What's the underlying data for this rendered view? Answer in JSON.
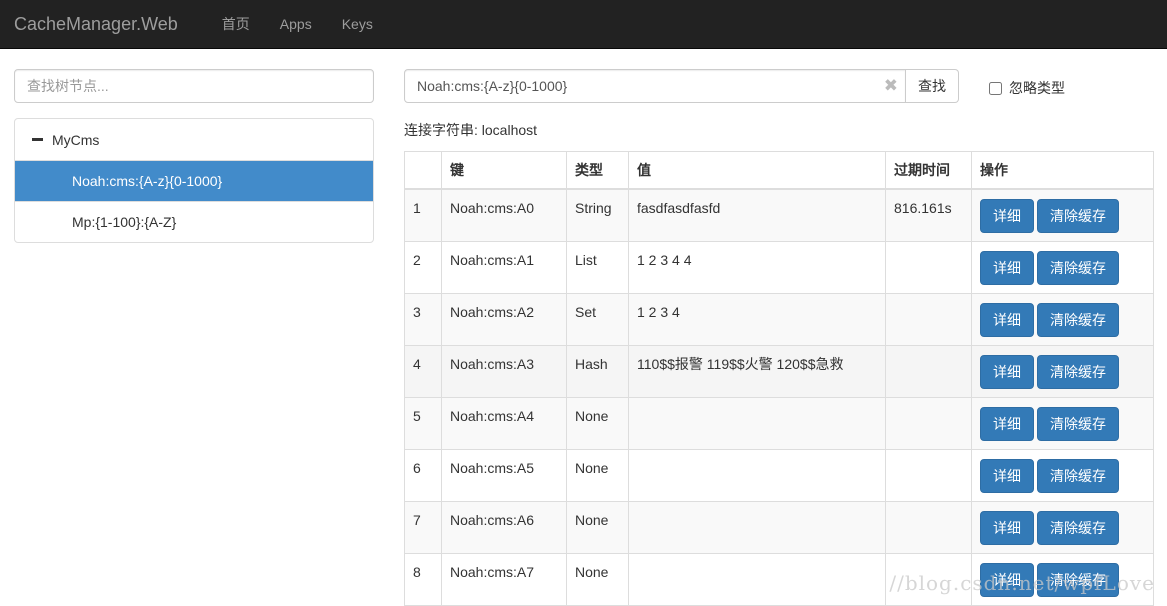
{
  "navbar": {
    "brand": "CacheManager.Web",
    "links": [
      "首页",
      "Apps",
      "Keys"
    ]
  },
  "sidebar": {
    "search_placeholder": "查找树节点...",
    "tree": {
      "root": {
        "label": "MyCms",
        "icon": "minus-icon",
        "expanded": true
      },
      "children": [
        {
          "label": "Noah:cms:{A-z}{0-1000}",
          "selected": true
        },
        {
          "label": "Mp:{1-100}:{A-Z}",
          "selected": false
        }
      ]
    },
    "selected_color": "#428bca"
  },
  "search": {
    "value": "Noah:cms:{A-z}{0-1000}",
    "clear_icon": "✖",
    "button_label": "查找",
    "ignore_type_label": "忽略类型",
    "ignore_type_checked": false
  },
  "connection": {
    "text": "连接字符串: localhost"
  },
  "table": {
    "headers": [
      "",
      "键",
      "类型",
      "值",
      "过期时间",
      "操作"
    ],
    "rows": [
      {
        "num": "1",
        "key": "Noah:cms:A0",
        "type": "String",
        "value": "fasdfasdfasfd",
        "expire": "816.161s"
      },
      {
        "num": "2",
        "key": "Noah:cms:A1",
        "type": "List",
        "value": "1 2 3 4 4",
        "expire": ""
      },
      {
        "num": "3",
        "key": "Noah:cms:A2",
        "type": "Set",
        "value": "1 2 3 4",
        "expire": ""
      },
      {
        "num": "4",
        "key": "Noah:cms:A3",
        "type": "Hash",
        "value": "110$$报警 119$$火警 120$$急救",
        "expire": ""
      },
      {
        "num": "5",
        "key": "Noah:cms:A4",
        "type": "None",
        "value": "",
        "expire": ""
      },
      {
        "num": "6",
        "key": "Noah:cms:A5",
        "type": "None",
        "value": "",
        "expire": ""
      },
      {
        "num": "7",
        "key": "Noah:cms:A6",
        "type": "None",
        "value": "",
        "expire": ""
      },
      {
        "num": "8",
        "key": "Noah:cms:A7",
        "type": "None",
        "value": "",
        "expire": ""
      }
    ],
    "detail_label": "详细",
    "clear_label": "清除缓存",
    "button_color": "#337ab7"
  },
  "watermark": "//blog.csdn.net/wpfLove"
}
